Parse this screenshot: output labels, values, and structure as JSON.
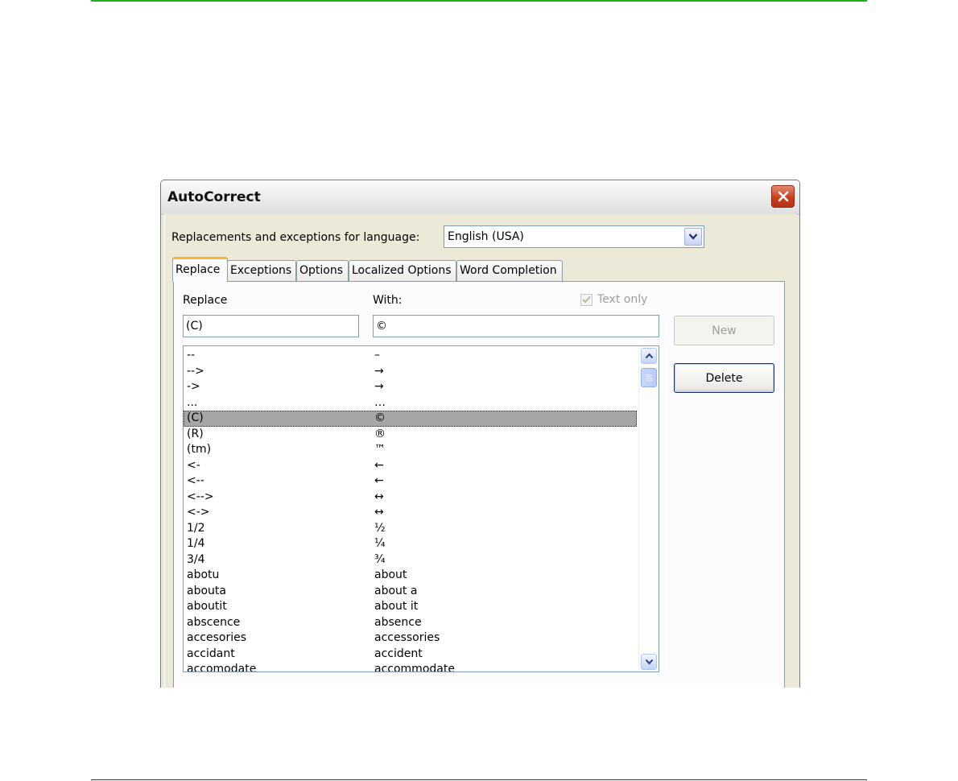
{
  "window": {
    "title": "AutoCorrect",
    "close_icon": "close-icon"
  },
  "language": {
    "label": "Replacements and exceptions for language:",
    "value": "English (USA)"
  },
  "tabs": [
    {
      "label": "Replace",
      "active": true
    },
    {
      "label": "Exceptions",
      "active": false
    },
    {
      "label": "Options",
      "active": false
    },
    {
      "label": "Localized Options",
      "active": false
    },
    {
      "label": "Word Completion",
      "active": false
    }
  ],
  "replace_tab": {
    "replace_label": "Replace",
    "with_label": "With:",
    "text_only_label": "Text only",
    "text_only_checked": true,
    "replace_value": "(C)",
    "with_value": "©",
    "new_button": "New",
    "delete_button": "Delete",
    "selected_index": 4,
    "rows": [
      {
        "replace": "--",
        "with": "–"
      },
      {
        "replace": "-->",
        "with": "→"
      },
      {
        "replace": "->",
        "with": "→"
      },
      {
        "replace": "...",
        "with": "…"
      },
      {
        "replace": "(C)",
        "with": "©"
      },
      {
        "replace": "(R)",
        "with": "®"
      },
      {
        "replace": "(tm)",
        "with": "™"
      },
      {
        "replace": "<-",
        "with": "←"
      },
      {
        "replace": "<--",
        "with": "←"
      },
      {
        "replace": "<-->",
        "with": "↔"
      },
      {
        "replace": "<->",
        "with": "↔"
      },
      {
        "replace": "1/2",
        "with": "½"
      },
      {
        "replace": "1/4",
        "with": "¼"
      },
      {
        "replace": "3/4",
        "with": "¾"
      },
      {
        "replace": "abotu",
        "with": "about"
      },
      {
        "replace": "abouta",
        "with": "about a"
      },
      {
        "replace": "aboutit",
        "with": "about it"
      },
      {
        "replace": "abscence",
        "with": "absence"
      },
      {
        "replace": "accesories",
        "with": "accessories"
      },
      {
        "replace": "accidant",
        "with": "accident"
      },
      {
        "replace": "accomodate",
        "with": "accommodate"
      }
    ]
  },
  "colors": {
    "accent_rule": "#16b416",
    "dialog_bg": "#ece9d8",
    "selection": "#a6a6a6",
    "close_button": "#c9401f"
  }
}
